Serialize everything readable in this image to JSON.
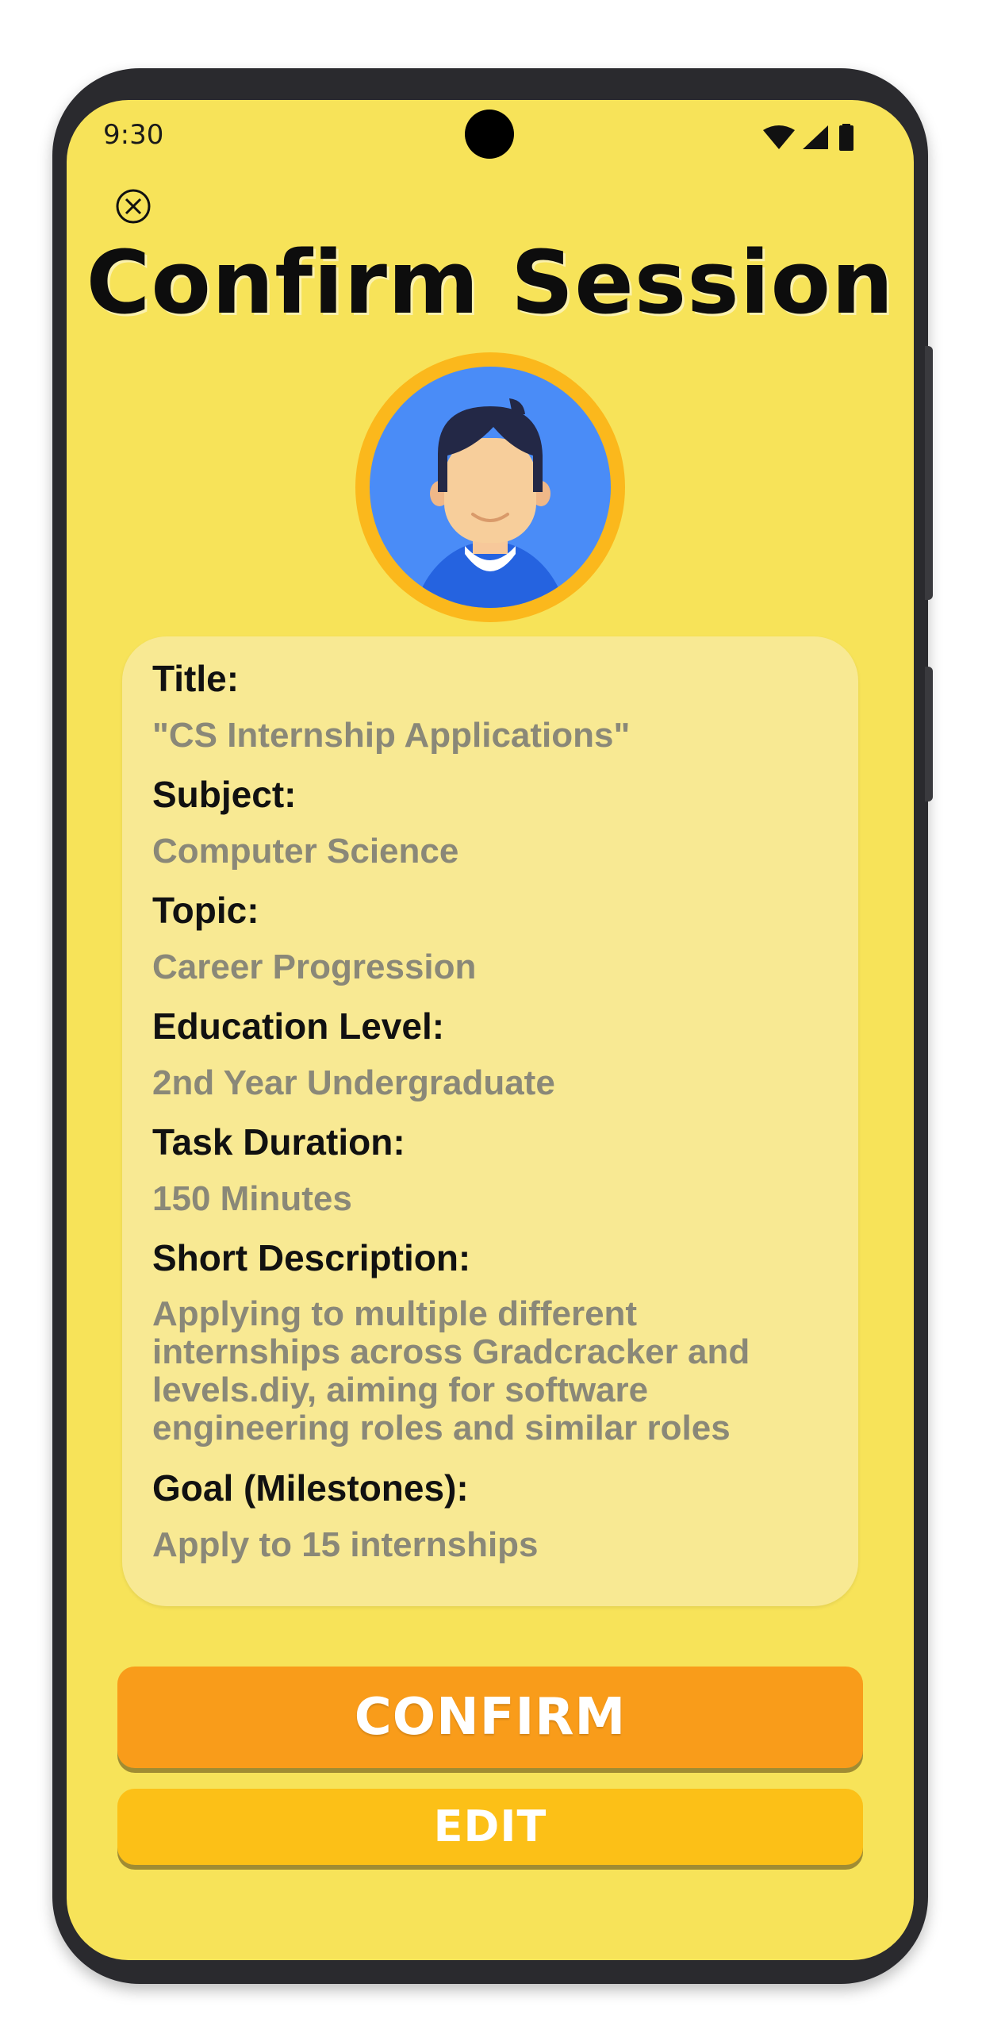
{
  "status_bar": {
    "time": "9:30",
    "icons": [
      "wifi-icon",
      "signal-icon",
      "battery-icon"
    ]
  },
  "header": {
    "close_icon": "close-circle-icon",
    "title": "Confirm Session"
  },
  "avatar": {
    "icon": "user-avatar-icon",
    "ring_color": "#fbb81c",
    "background_color": "#4a8cf7"
  },
  "session": {
    "fields": [
      {
        "label": "Title:",
        "value": "\"CS Internship Applications\""
      },
      {
        "label": "Subject:",
        "value": "Computer Science"
      },
      {
        "label": "Topic:",
        "value": "Career Progression"
      },
      {
        "label": "Education Level:",
        "value": "2nd Year Undergraduate"
      },
      {
        "label": "Task Duration:",
        "value": "150 Minutes"
      },
      {
        "label": "Short Description:",
        "value_lines": [
          "Applying to multiple different",
          "internships across Gradcracker and",
          "levels.diy, aiming for software",
          "engineering roles and similar roles"
        ]
      },
      {
        "label": "Goal (Milestones):",
        "value": "Apply to 15 internships"
      }
    ]
  },
  "actions": {
    "confirm_label": "CONFIRM",
    "edit_label": "EDIT"
  },
  "colors": {
    "screen_bg": "#f7e359",
    "card_bg": "#f8e993",
    "confirm": "#f99c1a",
    "edit": "#fcc017",
    "value_text": "#8a8878"
  }
}
